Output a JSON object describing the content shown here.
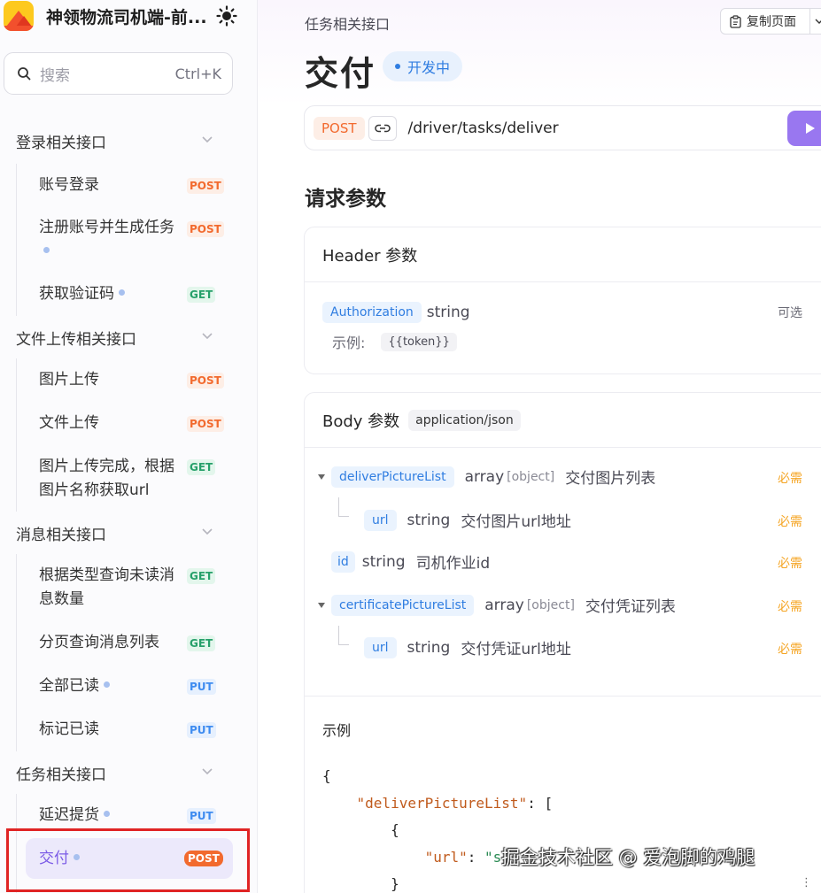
{
  "app": {
    "title": "神领物流司机端-前..."
  },
  "search": {
    "placeholder": "搜索",
    "shortcut": "Ctrl+K"
  },
  "sidebar": {
    "groups": [
      {
        "label": "登录相关接口",
        "items": [
          {
            "label": "账号登录",
            "method": "POST",
            "dot": false
          },
          {
            "label": "注册账号并生成任务",
            "method": "POST",
            "dot": true
          },
          {
            "label": "获取验证码",
            "method": "GET",
            "dot": true
          }
        ]
      },
      {
        "label": "文件上传相关接口",
        "items": [
          {
            "label": "图片上传",
            "method": "POST",
            "dot": false
          },
          {
            "label": "文件上传",
            "method": "POST",
            "dot": false
          },
          {
            "label": "图片上传完成，根据图片名称获取url",
            "method": "GET",
            "dot": false
          }
        ]
      },
      {
        "label": "消息相关接口",
        "items": [
          {
            "label": "根据类型查询未读消息数量",
            "method": "GET",
            "dot": false
          },
          {
            "label": "分页查询消息列表",
            "method": "GET",
            "dot": false
          },
          {
            "label": "全部已读",
            "method": "PUT",
            "dot": true
          },
          {
            "label": "标记已读",
            "method": "PUT",
            "dot": false
          }
        ]
      },
      {
        "label": "任务相关接口",
        "items": [
          {
            "label": "延迟提货",
            "method": "PUT",
            "dot": true
          },
          {
            "label": "交付",
            "method": "POST",
            "dot": true,
            "active": true
          }
        ]
      }
    ]
  },
  "main": {
    "breadcrumb": "任务相关接口",
    "copy_label": "复制页面",
    "title": "交付",
    "status": "开发中",
    "endpoint": {
      "method": "POST",
      "path": "/driver/tasks/deliver"
    },
    "section_title": "请求参数",
    "header_card": {
      "title": "Header 参数",
      "params": [
        {
          "name": "Authorization",
          "type": "string",
          "required_label": "可选",
          "example_label": "示例:",
          "example": "{{token}}"
        }
      ]
    },
    "body_card": {
      "title": "Body 参数",
      "content_type": "application/json",
      "params": [
        {
          "name": "deliverPictureList",
          "type": "array",
          "subtype": "[object]",
          "desc": "交付图片列表",
          "required": "必需"
        },
        {
          "name": "url",
          "type": "string",
          "desc": "交付图片url地址",
          "required": "必需"
        },
        {
          "name": "id",
          "type": "string",
          "desc": "司机作业id",
          "required": "必需"
        },
        {
          "name": "certificatePictureList",
          "type": "array",
          "subtype": "[object]",
          "desc": "交付凭证列表",
          "required": "必需"
        },
        {
          "name": "url",
          "type": "string",
          "desc": "交付凭证url地址",
          "required": "必需"
        }
      ]
    },
    "example": {
      "label": "示例",
      "lines": [
        "{",
        "\"deliverPictureList\"",
        ": [",
        "{",
        "\"url\"",
        ": ",
        "\"s",
        "}"
      ]
    }
  },
  "watermark": "掘金技术社区 @ 爱泡脚的鸡腿",
  "colors": {
    "accent": "#7b5be6",
    "post": "#f26a2e",
    "get": "#26a06a",
    "put": "#3f8cf0",
    "required": "#f5a524",
    "highlight_box": "#e02424"
  }
}
